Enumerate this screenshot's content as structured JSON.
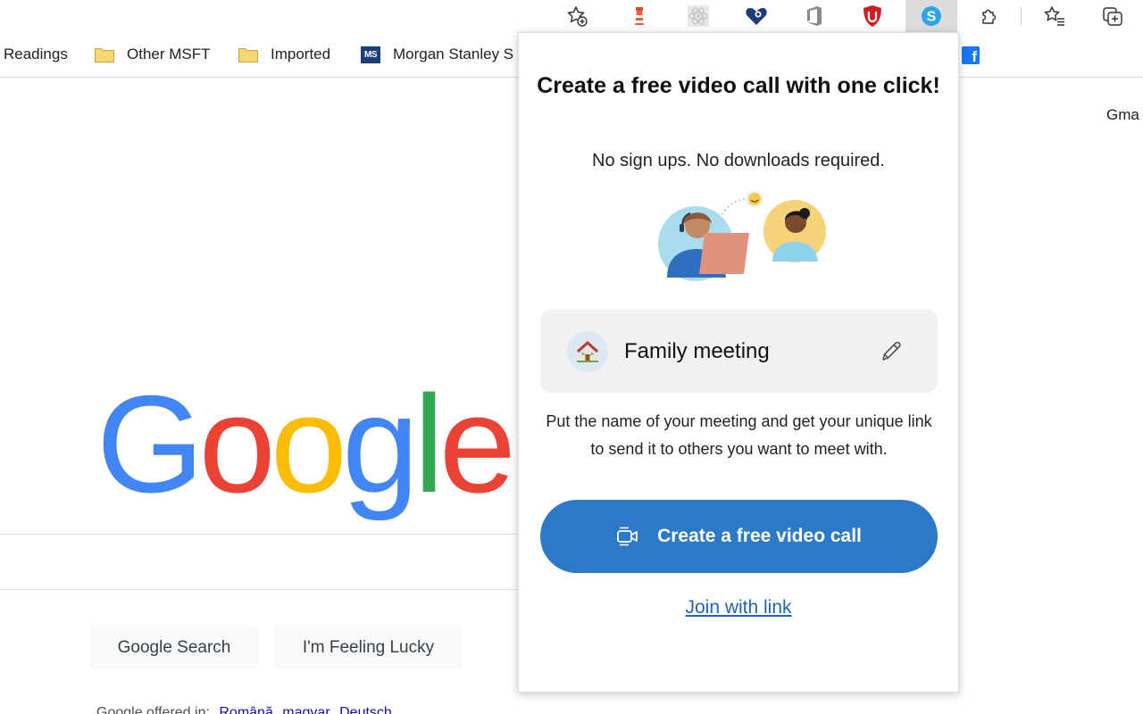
{
  "toolbar": {
    "icons": [
      "star-add-icon",
      "lighthouse-icon",
      "react-devtools-icon",
      "heart-extension-icon",
      "office-icon",
      "ublock-icon",
      "skype-icon",
      "extensions-puzzle-icon",
      "favorites-icon",
      "collections-icon"
    ]
  },
  "bookmarks": {
    "items": [
      {
        "label": "Readings"
      },
      {
        "label": "Other MSFT"
      },
      {
        "label": "Imported"
      },
      {
        "label": "Morgan Stanley S",
        "badge": "MS"
      }
    ],
    "facebook_glyph": "f"
  },
  "google": {
    "gmail_label": "Gma",
    "logo_letters": [
      "G",
      "o",
      "o",
      "g",
      "l",
      "e"
    ],
    "logo_colors": [
      "#4285f4",
      "#ea4335",
      "#fbbc05",
      "#4285f4",
      "#34a853",
      "#ea4335"
    ],
    "search_button": "Google Search",
    "lucky_button": "I'm Feeling Lucky",
    "offered_in": "Google offered in:",
    "languages": [
      "Română",
      "magyar",
      "Deutsch"
    ]
  },
  "popup": {
    "title": "Create a free video call with one click!",
    "subtitle": "No sign ups. No downloads required.",
    "meeting_name": "Family meeting",
    "description": "Put the name of your meeting and get your unique link to send it to others you want to meet with.",
    "create_button": "Create a free video call",
    "join_link": "Join with link",
    "accent_color": "#2d79c9",
    "link_color": "#1f64b8"
  }
}
